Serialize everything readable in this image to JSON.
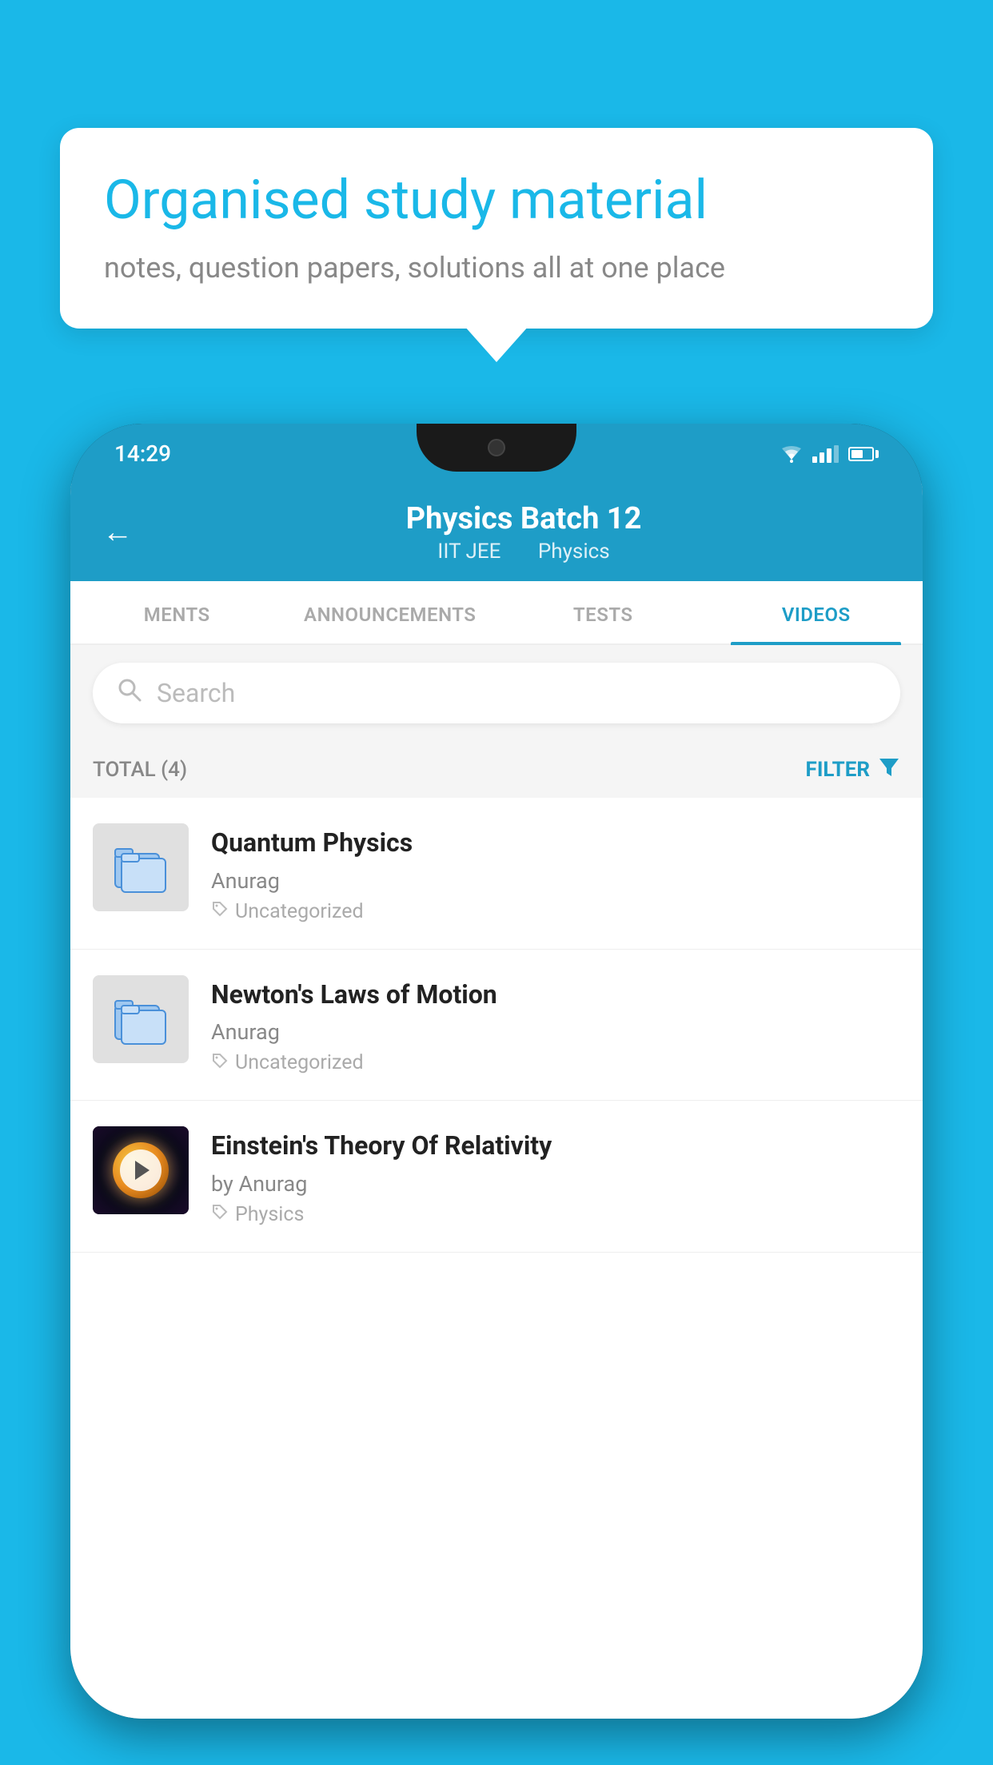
{
  "background_color": "#1AB8E8",
  "bubble": {
    "title": "Organised study material",
    "subtitle": "notes, question papers, solutions all at one place"
  },
  "phone": {
    "status_bar": {
      "time": "14:29"
    },
    "header": {
      "back_label": "←",
      "title": "Physics Batch 12",
      "subtitle_part1": "IIT JEE",
      "subtitle_part2": "Physics"
    },
    "tabs": [
      {
        "label": "MENTS",
        "active": false
      },
      {
        "label": "ANNOUNCEMENTS",
        "active": false
      },
      {
        "label": "TESTS",
        "active": false
      },
      {
        "label": "VIDEOS",
        "active": true
      }
    ],
    "search": {
      "placeholder": "Search"
    },
    "filter_bar": {
      "total_label": "TOTAL (4)",
      "filter_label": "FILTER"
    },
    "videos": [
      {
        "id": 1,
        "title": "Quantum Physics",
        "author": "Anurag",
        "tag": "Uncategorized",
        "has_thumbnail": false
      },
      {
        "id": 2,
        "title": "Newton's Laws of Motion",
        "author": "Anurag",
        "tag": "Uncategorized",
        "has_thumbnail": false
      },
      {
        "id": 3,
        "title": "Einstein's Theory Of Relativity",
        "author": "by Anurag",
        "tag": "Physics",
        "has_thumbnail": true
      }
    ]
  }
}
